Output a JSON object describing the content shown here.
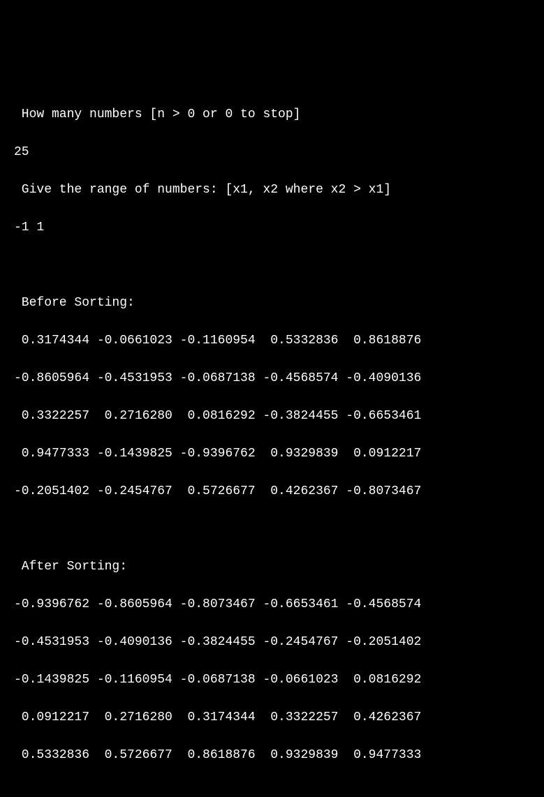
{
  "prompts": {
    "how_many": " How many numbers [n > 0 or 0 to stop]",
    "count_input": "25",
    "range_prompt": " Give the range of numbers: [x1, x2 where x2 > x1]",
    "range_input": "-1 1"
  },
  "before_label": " Before Sorting:",
  "after_label": " After Sorting:",
  "before_sorting": [
    [
      " 0.3174344",
      "-0.0661023",
      "-0.1160954",
      " 0.5332836",
      " 0.8618876"
    ],
    [
      "-0.8605964",
      "-0.4531953",
      "-0.0687138",
      "-0.4568574",
      "-0.4090136"
    ],
    [
      " 0.3322257",
      " 0.2716280",
      " 0.0816292",
      "-0.3824455",
      "-0.6653461"
    ],
    [
      " 0.9477333",
      "-0.1439825",
      "-0.9396762",
      " 0.9329839",
      " 0.0912217"
    ],
    [
      "-0.2051402",
      "-0.2454767",
      " 0.5726677",
      " 0.4262367",
      "-0.8073467"
    ]
  ],
  "after_sorting": [
    [
      "-0.9396762",
      "-0.8605964",
      "-0.8073467",
      "-0.6653461",
      "-0.4568574"
    ],
    [
      "-0.4531953",
      "-0.4090136",
      "-0.3824455",
      "-0.2454767",
      "-0.2051402"
    ],
    [
      "-0.1439825",
      "-0.1160954",
      "-0.0687138",
      "-0.0661023",
      " 0.0816292"
    ],
    [
      " 0.0912217",
      " 0.2716280",
      " 0.3174344",
      " 0.3322257",
      " 0.4262367"
    ],
    [
      " 0.5332836",
      " 0.5726677",
      " 0.8618876",
      " 0.9329839",
      " 0.9477333"
    ]
  ]
}
